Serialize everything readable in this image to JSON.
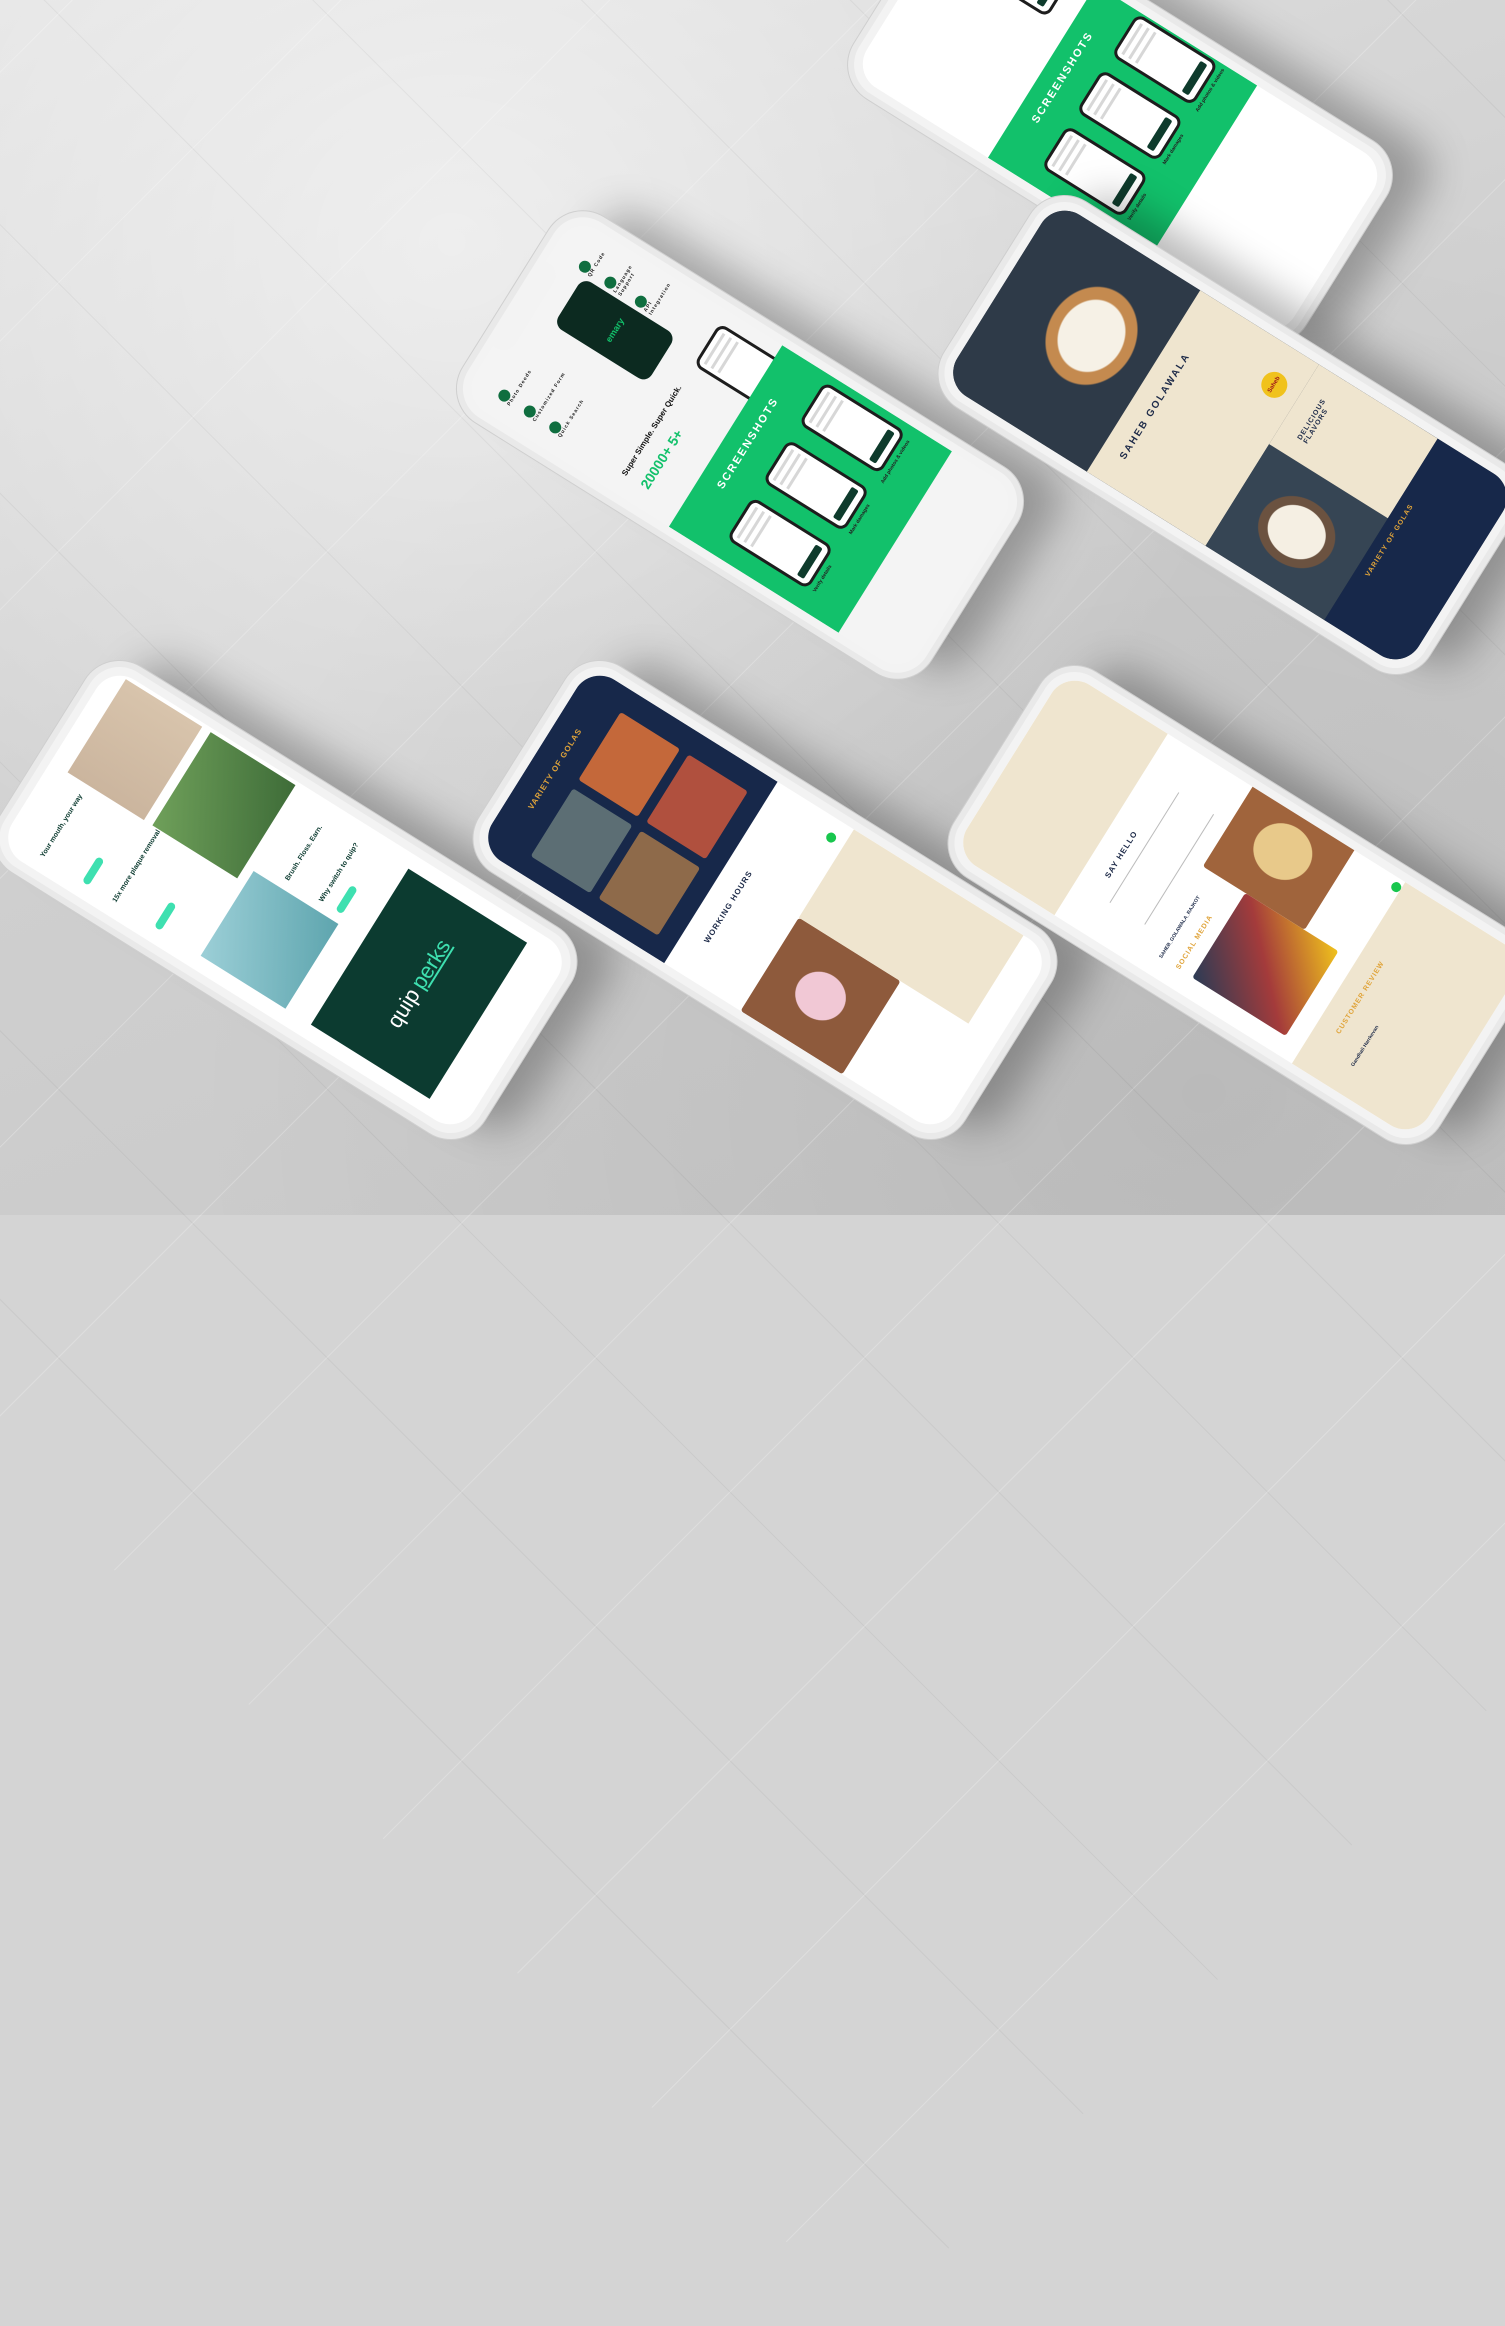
{
  "emary": {
    "brand": "emary",
    "features": [
      "Photo Deeds",
      "Customized Form",
      "Quick Search",
      "QR Code",
      "Language Support",
      "API Integration"
    ],
    "tagline": "Super Simple. Super Quick.",
    "stat_value": "20000+ 5+",
    "screenshots_title": "SCREENSHOTS",
    "captions": [
      "Verify details",
      "Mark damages",
      "Add photos & videos"
    ]
  },
  "golawala": {
    "brand_title": "SAHEB GOLAWALA",
    "logo_text": "Saheb",
    "menu_title": "DELICIOUS FLAVORS",
    "variety_title": "VARIETY OF GOLAS",
    "hours_title": "WORKING HOURS",
    "say_hello": "SAY HELLO",
    "social_title": "SOCIAL MEDIA",
    "social_handle": "SAHEB_GOLAWALA_RAJKOT",
    "review_title": "CUSTOMER REVIEW",
    "review_author": "Gandhali Harrkevan"
  },
  "quip": {
    "feature_1": "Your mouth, your way",
    "feature_2": "15x more plaque removal",
    "feature_3": "Brush. Floss. Earn.",
    "feature_4": "Why switch to quip?",
    "logo_main": "quip",
    "logo_accent": "perks"
  },
  "colors": {
    "green": "#12c16b",
    "navy": "#17284a",
    "cream": "#efe5cf",
    "quip_dark": "#0c3b30",
    "quip_mint": "#3ee0b0"
  }
}
